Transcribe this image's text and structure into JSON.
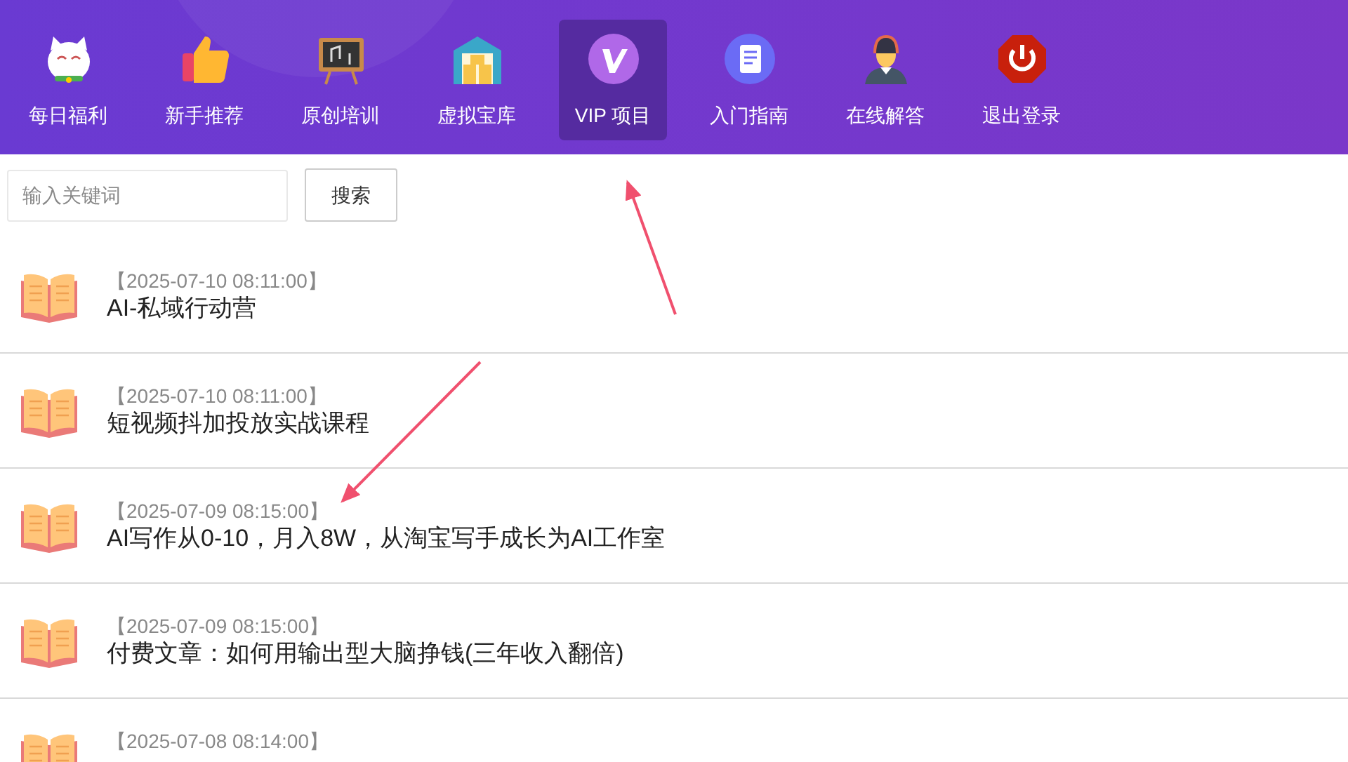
{
  "nav": [
    {
      "label": "每日福利",
      "selected": false
    },
    {
      "label": "新手推荐",
      "selected": false
    },
    {
      "label": "原创培训",
      "selected": false
    },
    {
      "label": "虚拟宝库",
      "selected": false
    },
    {
      "label": "VIP 项目",
      "selected": true
    },
    {
      "label": "入门指南",
      "selected": false
    },
    {
      "label": "在线解答",
      "selected": false
    },
    {
      "label": "退出登录",
      "selected": false
    }
  ],
  "search": {
    "placeholder": "输入关键词",
    "button": "搜索"
  },
  "articles": [
    {
      "date": "【2025-07-10 08:11:00】",
      "title": "AI-私域行动营"
    },
    {
      "date": "【2025-07-10 08:11:00】",
      "title": "短视频抖加投放实战课程"
    },
    {
      "date": "【2025-07-09 08:15:00】",
      "title": "AI写作从0-10，月入8W，从淘宝写手成长为AI工作室"
    },
    {
      "date": "【2025-07-09 08:15:00】",
      "title": "付费文章：如何用输出型大脑挣钱(三年收入翻倍)"
    },
    {
      "date": "【2025-07-08 08:14:00】"
    }
  ]
}
